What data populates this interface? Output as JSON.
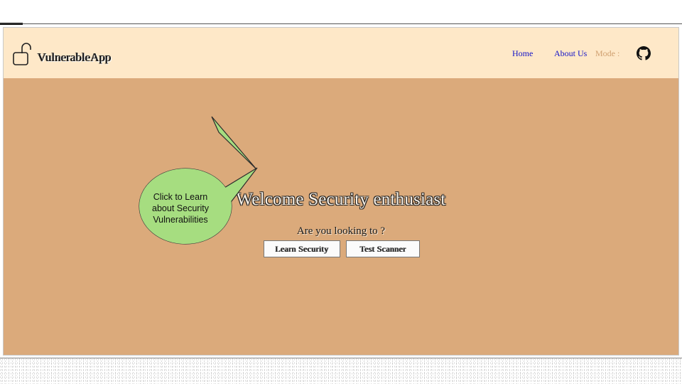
{
  "navbar": {
    "brand": "VulnerableApp",
    "links": {
      "home": "Home",
      "about": "About Us",
      "mode": "Mode :"
    },
    "icons": {
      "brand_icon": "unlocked-padlock-icon",
      "github_icon": "github-icon"
    }
  },
  "hero": {
    "title": "Welcome Security enthusiast",
    "question": "Are you looking to ?",
    "buttons": {
      "learn": "Learn Security",
      "test": "Test Scanner"
    },
    "callout": {
      "line1": "Click to Learn",
      "line2": "about Security",
      "line3": "Vulnerabilities"
    }
  },
  "colors": {
    "navbar_bg": "#fee8c8",
    "hero_bg": "#dbaa7b",
    "link": "#1414c8",
    "mode_link": "#d0a070",
    "callout_fill": "#a6dd80"
  }
}
